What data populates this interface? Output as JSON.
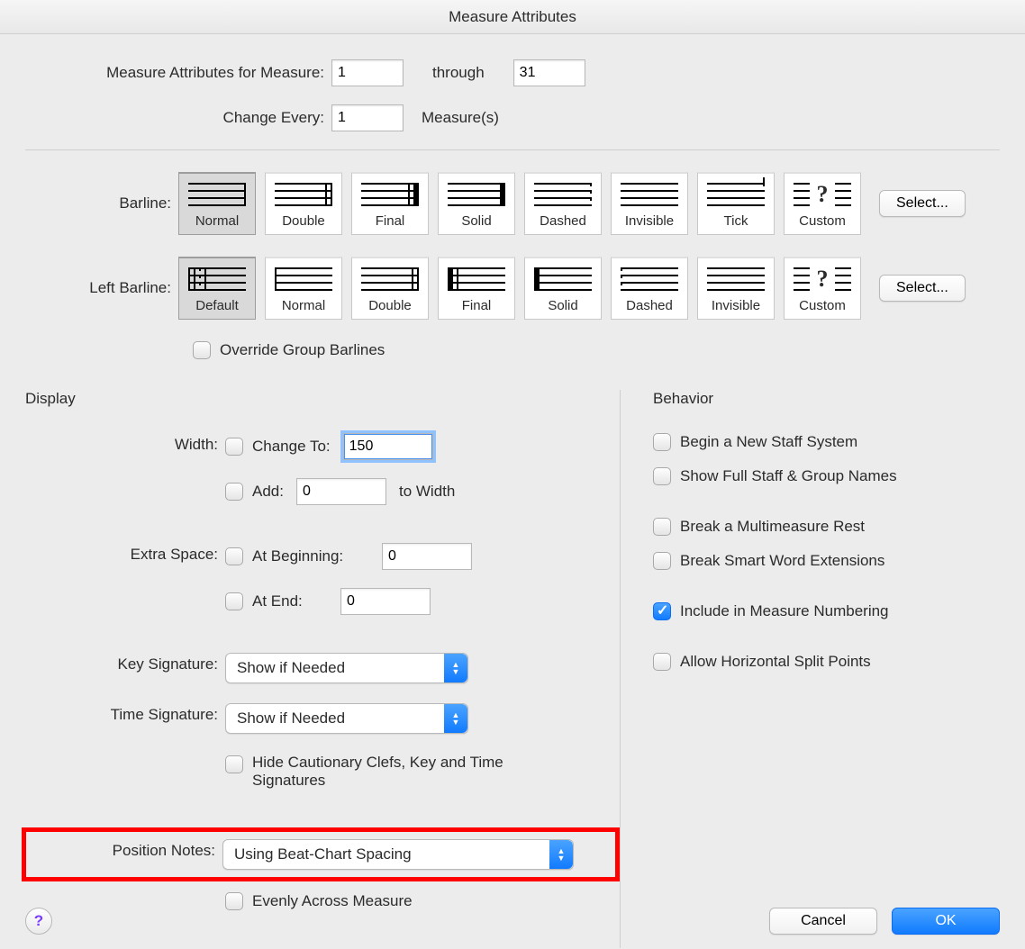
{
  "title": "Measure Attributes",
  "top": {
    "attr_label": "Measure Attributes for Measure:",
    "from": "1",
    "through_label": "through",
    "to": "31",
    "change_every_label": "Change Every:",
    "change_every_value": "1",
    "measures_suffix": "Measure(s)"
  },
  "barline": {
    "label": "Barline:",
    "items": [
      "Normal",
      "Double",
      "Final",
      "Solid",
      "Dashed",
      "Invisible",
      "Tick",
      "Custom"
    ],
    "selected": 0,
    "select_button": "Select..."
  },
  "left_barline": {
    "label": "Left Barline:",
    "items": [
      "Default",
      "Normal",
      "Double",
      "Final",
      "Solid",
      "Dashed",
      "Invisible",
      "Custom"
    ],
    "selected": 0,
    "select_button": "Select..."
  },
  "override": {
    "label": "Override Group Barlines",
    "checked": false
  },
  "display": {
    "title": "Display",
    "width_label": "Width:",
    "change_to_label": "Change To:",
    "change_to_value": "150",
    "change_to_checked": false,
    "add_label": "Add:",
    "add_value": "0",
    "add_suffix": "to Width",
    "add_checked": false,
    "extra_space_label": "Extra Space:",
    "at_beginning_label": "At Beginning:",
    "at_beginning_value": "0",
    "at_beginning_checked": false,
    "at_end_label": "At End:",
    "at_end_value": "0",
    "at_end_checked": false,
    "key_sig_label": "Key Signature:",
    "key_sig_value": "Show if Needed",
    "time_sig_label": "Time Signature:",
    "time_sig_value": "Show if Needed",
    "hide_cautionary_label": "Hide Cautionary Clefs, Key and Time Signatures",
    "hide_cautionary_checked": false,
    "position_notes_label": "Position Notes:",
    "position_notes_value": "Using Beat-Chart Spacing",
    "evenly_label": "Evenly Across Measure",
    "evenly_checked": false
  },
  "behavior": {
    "title": "Behavior",
    "items": [
      {
        "label": "Begin a New Staff System",
        "checked": false
      },
      {
        "label": "Show Full Staff & Group Names",
        "checked": false
      },
      {
        "label": "Break a Multimeasure Rest",
        "checked": false
      },
      {
        "label": "Break Smart Word Extensions",
        "checked": false
      },
      {
        "label": "Include in Measure Numbering",
        "checked": true
      },
      {
        "label": "Allow Horizontal Split Points",
        "checked": false
      }
    ]
  },
  "footer": {
    "help": "?",
    "cancel": "Cancel",
    "ok": "OK"
  }
}
